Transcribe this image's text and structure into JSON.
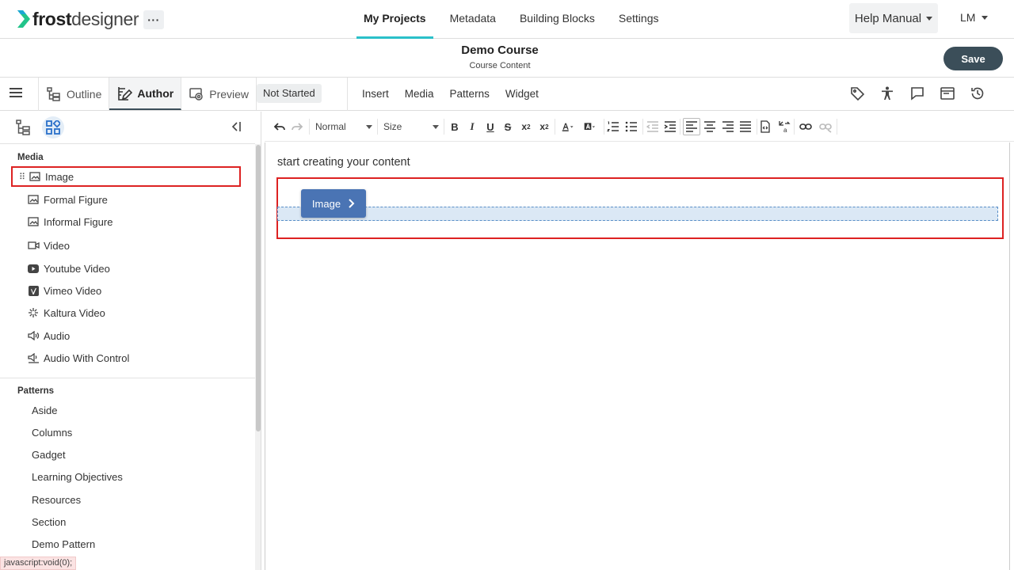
{
  "app": {
    "logo_brand": "frost",
    "logo_suffix": "designer",
    "more_label": "···"
  },
  "nav": {
    "items": [
      "My Projects",
      "Metadata",
      "Building Blocks",
      "Settings"
    ],
    "active": "My Projects",
    "help_label": "Help Manual",
    "user_initials": "LM"
  },
  "course": {
    "title": "Demo Course",
    "subtitle": "Course Content",
    "save_label": "Save"
  },
  "modes": {
    "tabs": [
      {
        "label": "Outline",
        "icon": "outline-icon"
      },
      {
        "label": "Author",
        "icon": "author-icon",
        "active": true
      },
      {
        "label": "Preview",
        "icon": "preview-icon"
      }
    ],
    "status": "Not Started",
    "insert_menu": [
      "Insert",
      "Media",
      "Patterns",
      "Widget"
    ],
    "right_icons": [
      "tag-icon",
      "accessibility-icon",
      "comment-icon",
      "panel-icon",
      "history-icon"
    ]
  },
  "sidebar": {
    "media_title": "Media",
    "media_items": [
      {
        "label": "Image",
        "icon": "image-icon",
        "selected": true
      },
      {
        "label": "Formal Figure",
        "icon": "image-icon"
      },
      {
        "label": "Informal Figure",
        "icon": "image-icon"
      },
      {
        "label": "Video",
        "icon": "video-icon"
      },
      {
        "label": "Youtube Video",
        "icon": "youtube-icon"
      },
      {
        "label": "Vimeo Video",
        "icon": "vimeo-icon"
      },
      {
        "label": "Kaltura Video",
        "icon": "kaltura-icon"
      },
      {
        "label": "Audio",
        "icon": "audio-icon"
      },
      {
        "label": "Audio With Control",
        "icon": "audio-control-icon"
      }
    ],
    "patterns_title": "Patterns",
    "pattern_items": [
      "Aside",
      "Columns",
      "Gadget",
      "Learning Objectives",
      "Resources",
      "Section",
      "Demo Pattern"
    ]
  },
  "toolbar": {
    "format_value": "Normal",
    "size_value": "Size"
  },
  "editor": {
    "placeholder": "start creating your content",
    "drag_label": "Image"
  },
  "statusbar": {
    "text": "javascript:void(0);"
  },
  "colors": {
    "accent_teal": "#2bc0c9",
    "save_bg": "#3b4e59",
    "drag_chip": "#4a74b4",
    "highlight_red": "#dd2222"
  }
}
